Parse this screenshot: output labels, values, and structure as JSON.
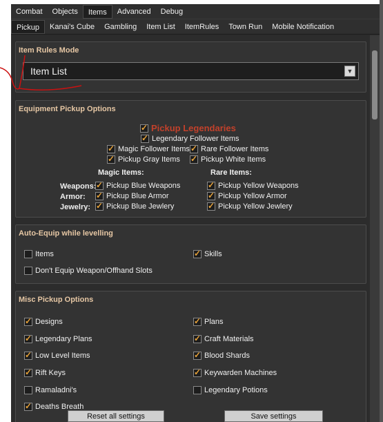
{
  "tabs_top": [
    "Combat",
    "Objects",
    "Items",
    "Advanced",
    "Debug"
  ],
  "tabs_top_active": 2,
  "tabs_sub": [
    "Pickup",
    "Kanai's Cube",
    "Gambling",
    "Item List",
    "ItemRules",
    "Town Run",
    "Mobile Notification"
  ],
  "tabs_sub_active": 0,
  "item_rules": {
    "title": "Item Rules Mode",
    "dropdown_value": "Item List"
  },
  "equipment": {
    "title": "Equipment Pickup Options",
    "pickup_legendaries": "Pickup Legendaries",
    "legendary_follower": "Legendary Follower Items",
    "magic_follower": "Magic Follower Items",
    "rare_follower": "Rare Follower Items",
    "pickup_gray": "Pickup Gray Items",
    "pickup_white": "Pickup White Items",
    "magic_header": "Magic Items:",
    "rare_header": "Rare Items:",
    "weapons_label": "Weapons:",
    "armor_label": "Armor:",
    "jewelry_label": "Jewelry:",
    "blue_weapons": "Pickup Blue Weapons",
    "blue_armor": "Pickup Blue Armor",
    "blue_jewelry": "Pickup Blue Jewlery",
    "yellow_weapons": "Pickup Yellow Weapons",
    "yellow_armor": "Pickup Yellow Armor",
    "yellow_jewelry": "Pickup Yellow Jewlery"
  },
  "auto_equip": {
    "title": "Auto-Equip while levelling",
    "items": "Items",
    "skills": "Skills",
    "dont_equip": "Don't Equip Weapon/Offhand Slots"
  },
  "misc": {
    "title": "Misc Pickup Options",
    "designs": "Designs",
    "plans": "Plans",
    "legendary_plans": "Legendary Plans",
    "craft_materials": "Craft Materials",
    "low_level": "Low Level Items",
    "blood_shards": "Blood Shards",
    "rift_keys": "Rift Keys",
    "keywarden": "Keywarden Machines",
    "ramaladni": "Ramaladni's",
    "legendary_potions": "Legendary Potions",
    "deaths_breath": "Deaths Breath"
  },
  "buttons": {
    "reset": "Reset all settings",
    "save": "Save settings"
  },
  "colors": {
    "accent_check": "#e8a33a",
    "group_title": "#e6c7a4",
    "legendary_red": "#c2412b",
    "annotation": "#cc1111"
  }
}
